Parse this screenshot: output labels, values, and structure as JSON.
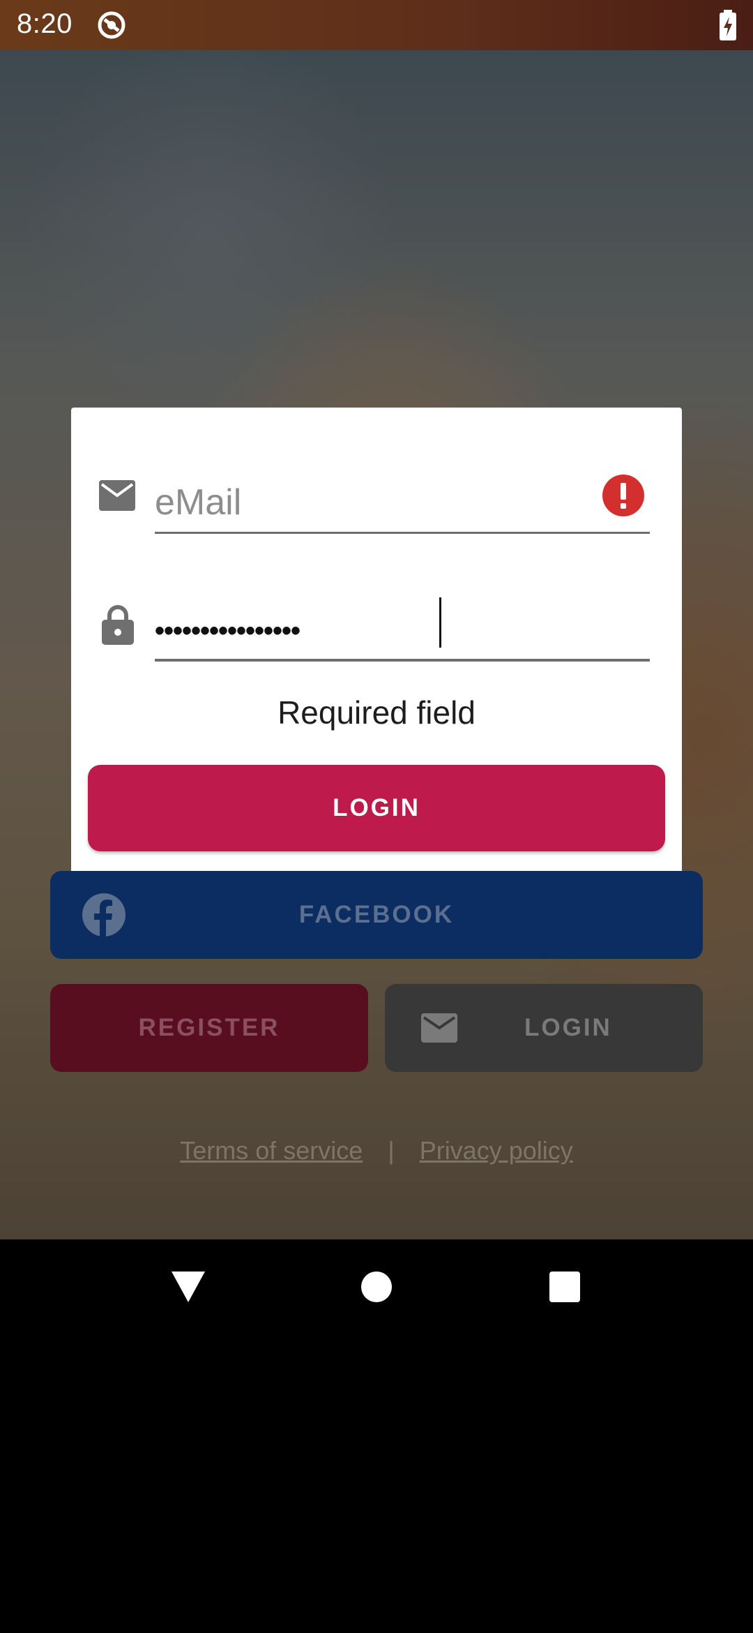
{
  "status_bar": {
    "time": "8:20"
  },
  "login_card": {
    "email_placeholder": "eMail",
    "password_value": "••••••••••••••••",
    "error_message": "Required field",
    "login_button": "LOGIN"
  },
  "social": {
    "facebook_label": "FACEBOOK"
  },
  "actions": {
    "register_label": "REGISTER",
    "email_login_label": "LOGIN"
  },
  "footer": {
    "terms": "Terms of service",
    "separator": "|",
    "privacy": "Privacy policy"
  },
  "colors": {
    "accent": "#be1a4c",
    "error": "#d32f2f",
    "facebook": "#0c2d62",
    "register": "#580e1f",
    "email_login": "#383838"
  }
}
